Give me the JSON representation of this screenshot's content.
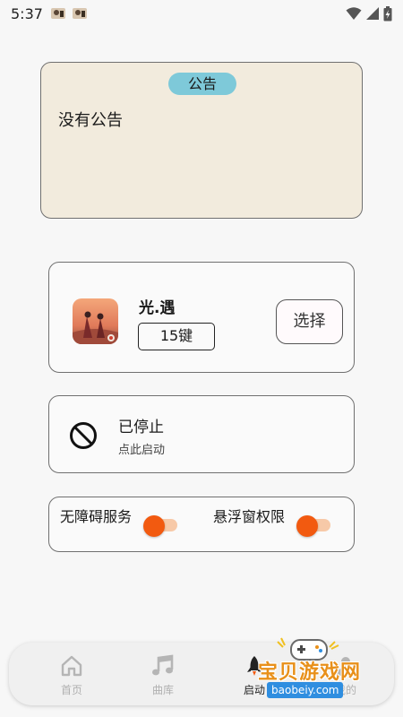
{
  "status_bar": {
    "time": "5:37"
  },
  "announcement": {
    "title": "公告",
    "text": "没有公告"
  },
  "game": {
    "name": "光.遇",
    "keys": "15键",
    "select_label": "选择"
  },
  "service_status": {
    "title": "已停止",
    "subtitle": "点此启动"
  },
  "toggles": {
    "accessibility": {
      "label": "无障碍服务",
      "on": false
    },
    "overlay": {
      "label": "悬浮窗权限",
      "on": false
    }
  },
  "nav": {
    "home": "首页",
    "library": "曲库",
    "start": "启动",
    "mine": "我的"
  },
  "watermark": {
    "name": "宝贝游戏网",
    "url": "baobeiy.com"
  },
  "colors": {
    "announce_bg": "#f2ebdd",
    "announce_pill": "#7ec9d9",
    "toggle_thumb": "#f25a10",
    "toggle_track": "#f7c9a8"
  }
}
